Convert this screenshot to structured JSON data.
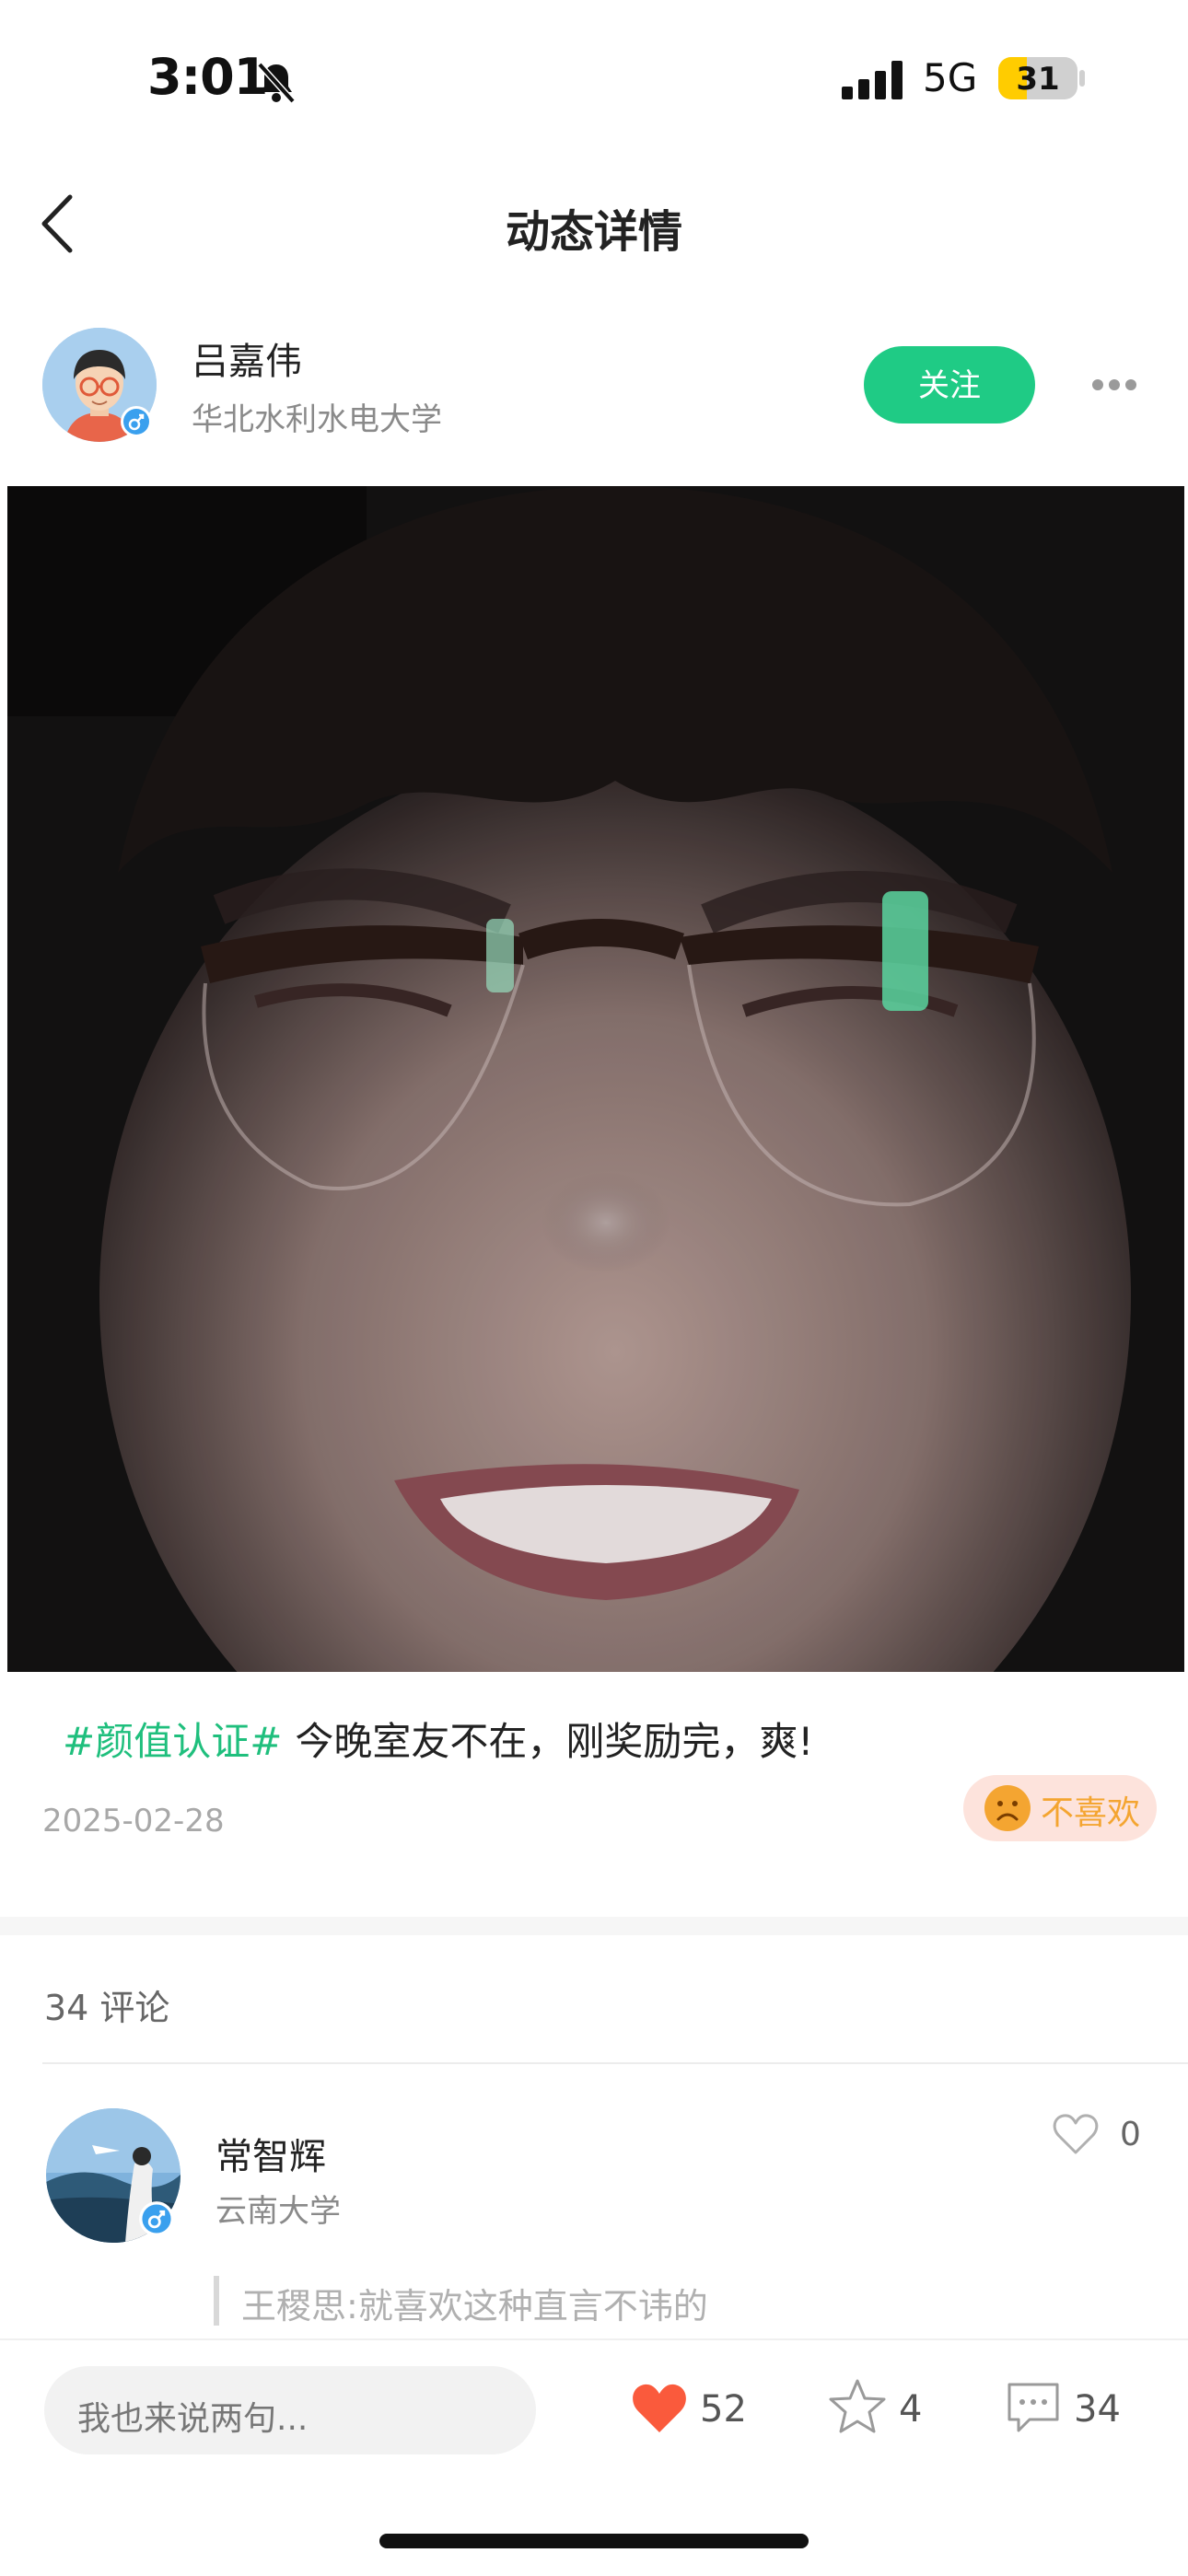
{
  "status_bar": {
    "time": "3:01",
    "network": "5G",
    "battery": "31"
  },
  "nav": {
    "title": "动态详情"
  },
  "author": {
    "name": "吕嘉伟",
    "school": "华北水利水电大学",
    "follow_label": "关注"
  },
  "post": {
    "tag": "#颜值认证#",
    "text": "今晚室友不在，刚奖励完，爽!",
    "date": "2025-02-28",
    "dislike_label": "不喜欢"
  },
  "comments": {
    "count_label": "34 评论",
    "items": [
      {
        "name": "常智辉",
        "school": "云南大学",
        "likes": "0",
        "reply": "王稷思:就喜欢这种直言不讳的"
      }
    ]
  },
  "bottom_bar": {
    "input_placeholder": "我也来说两句...",
    "likes": "52",
    "favorites": "4",
    "comments": "34"
  },
  "colors": {
    "accent_green": "#1fcb85",
    "like_red": "#fa5a3c",
    "dislike_orange": "#f4a531"
  }
}
